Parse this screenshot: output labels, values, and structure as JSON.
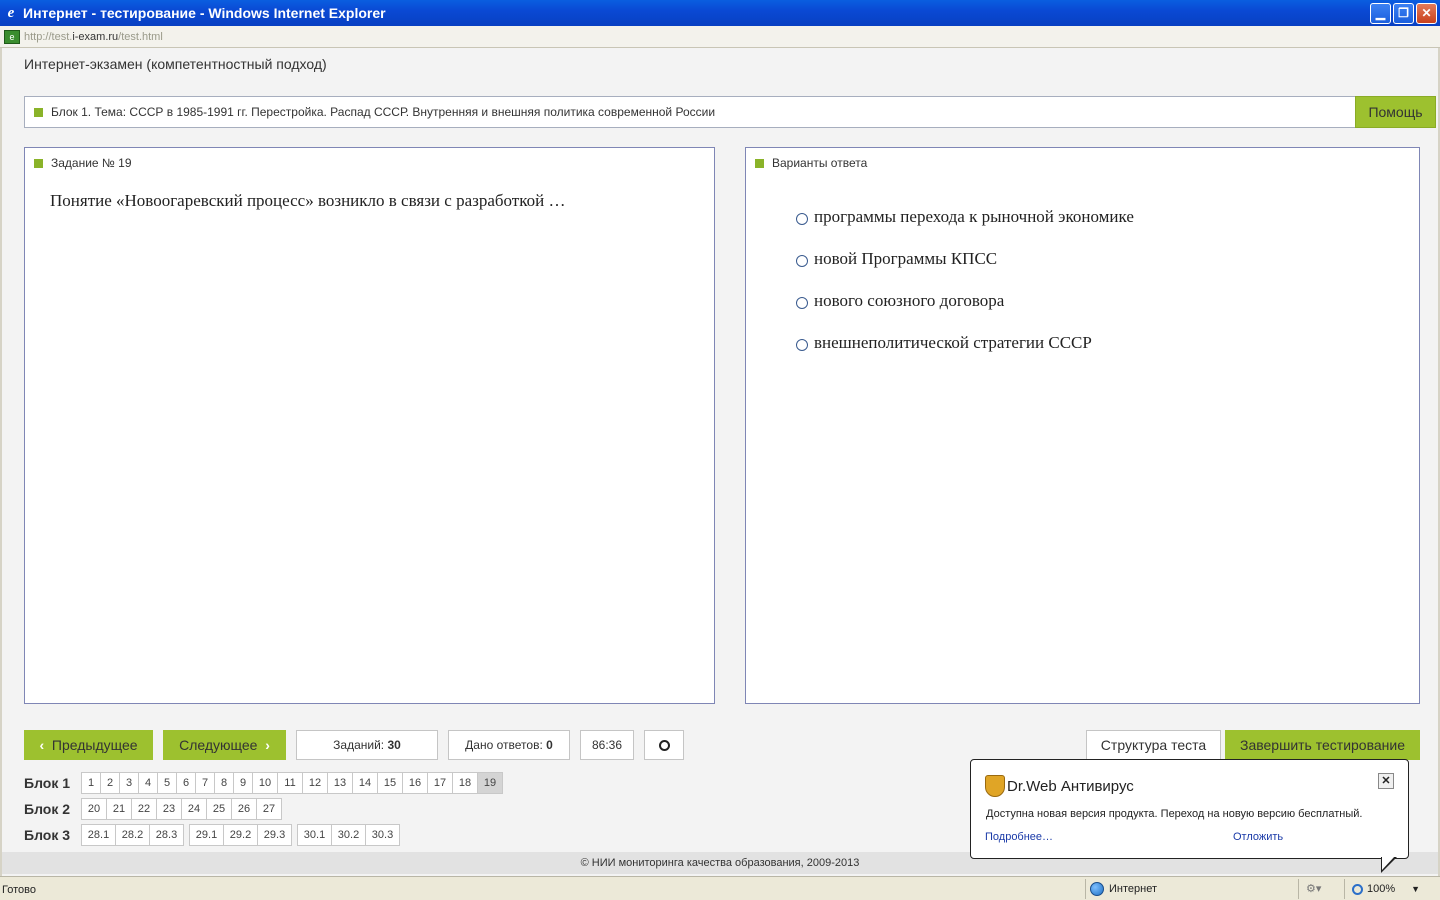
{
  "window": {
    "title": "Интернет - тестирование - Windows Internet Explorer",
    "url_prefix": "http://test.",
    "url_host": "i-exam.ru",
    "url_path": "/test.html"
  },
  "exam": {
    "title": "Интернет-экзамен (компетентностный подход)",
    "block_topic": "Блок 1. Тема: СССР в 1985-1991 гг. Перестройка. Распад СССР. Внутренняя и внешняя политика современной России",
    "help_label": "Помощь"
  },
  "task": {
    "header": "Задание № 19",
    "question": "Понятие «Новоогаревский процесс» возникло в связи с разработкой …"
  },
  "answers": {
    "header": "Варианты ответа",
    "options": [
      "программы перехода к рыночной экономике",
      "новой Программы КПСС",
      "нового союзного договора",
      "внешнеполитической стратегии СССР"
    ]
  },
  "controls": {
    "prev_label": "Предыдущее",
    "next_label": "Следующее",
    "tasks_label": "Заданий:",
    "tasks_value": "30",
    "answered_label": "Дано ответов:",
    "answered_value": "0",
    "timer": "86:36",
    "structure_label": "Структура теста",
    "finish_label": "Завершить тестирование"
  },
  "blocks": [
    {
      "label": "Блок 1",
      "cells": [
        "1",
        "2",
        "3",
        "4",
        "5",
        "6",
        "7",
        "8",
        "9",
        "10",
        "11",
        "12",
        "13",
        "14",
        "15",
        "16",
        "17",
        "18",
        "19"
      ],
      "selected": "19"
    },
    {
      "label": "Блок 2",
      "cells": [
        "20",
        "21",
        "22",
        "23",
        "24",
        "25",
        "26",
        "27"
      ]
    },
    {
      "label": "Блок 3",
      "groups": [
        [
          "28.1",
          "28.2",
          "28.3"
        ],
        [
          "29.1",
          "29.2",
          "29.3"
        ],
        [
          "30.1",
          "30.2",
          "30.3"
        ]
      ]
    }
  ],
  "footer": "© НИИ мониторинга качества образования, 2009-2013",
  "popup": {
    "title": "Dr.Web Антивирус",
    "message": "Доступна новая версия продукта. Переход на новую версию бесплатный.",
    "more_link": "Подробнее…",
    "later_link": "Отложить"
  },
  "statusbar": {
    "status": "Готово",
    "zone": "Интернет",
    "zoom": "100%"
  },
  "colors": {
    "accent_green": "#9dc12f",
    "titlebar_blue": "#0a5ee0",
    "panel_border": "#7f86b5"
  }
}
